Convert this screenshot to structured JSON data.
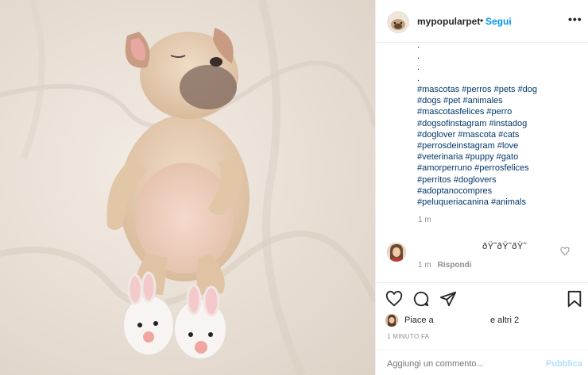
{
  "post": {
    "image_alt_subject": "puppy sleeping wearing bunny slippers"
  },
  "header": {
    "username": "mypopularpet",
    "separator": "•",
    "follow_label": "Segui",
    "more_icon": "more-horizontal-icon",
    "more_glyph": "•••"
  },
  "caption": {
    "dots": [
      ".",
      ".",
      ".",
      "."
    ],
    "hashtag_lines": [
      "#mascotas #perros #pets #dog",
      "#dogs #pet #animales",
      "#mascotasfelices #perro",
      "#dogsofinstagram #instadog",
      "#doglover #mascota #cats",
      "#perrosdeinstagram #love",
      "#veterinaria #puppy #gato",
      "#amorperruno #perrosfelices",
      "#perritos #doglovers",
      "#adoptanocompres",
      "#peluqueriacanina #animals"
    ],
    "time": "1 m"
  },
  "comment": {
    "text": "ðŸ˜ðŸ˜ðŸ˜",
    "time": "1 m",
    "reply_label": "Rispondi",
    "heart_icon": "heart-outline-icon"
  },
  "actions": {
    "like_icon": "heart-outline-icon",
    "comment_icon": "comment-bubble-icon",
    "share_icon": "paper-plane-icon",
    "save_icon": "bookmark-icon"
  },
  "likes": {
    "prefix": "Piace a",
    "suffix": "e altri 2"
  },
  "post_time": "1 MINUTO FA",
  "comment_box": {
    "placeholder": "Aggiungi un commento...",
    "publish_label": "Pubblica"
  },
  "colors": {
    "link": "#00376b",
    "follow": "#0095f6",
    "publish_disabled": "#b2dffc",
    "muted": "#8e8e8e",
    "text": "#262626"
  }
}
